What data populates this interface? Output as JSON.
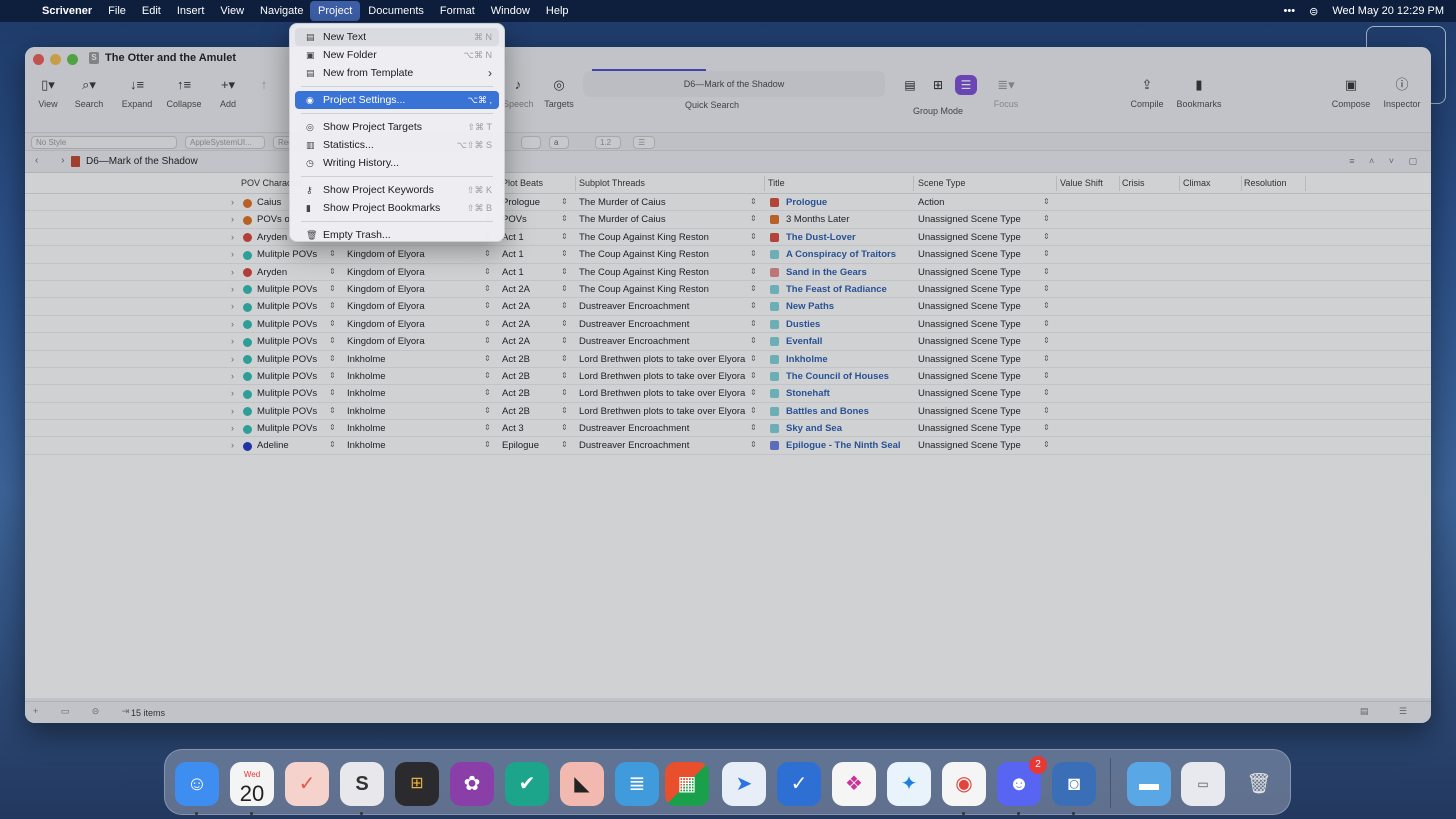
{
  "menubar": {
    "app": "Scrivener",
    "items": [
      "File",
      "Edit",
      "Insert",
      "View",
      "Navigate",
      "Project",
      "Documents",
      "Format",
      "Window",
      "Help"
    ],
    "active": "Project",
    "datetime": "Wed May 20  12:29 PM"
  },
  "window": {
    "title": "The Otter and the Amulet",
    "toolbar": {
      "view": "View",
      "search": "Search",
      "expand": "Expand",
      "collapse": "Collapse",
      "add": "Add",
      "speech": "Speech",
      "targets": "Targets",
      "quick_search_value": "D6—Mark of the Shadow",
      "quick_search": "Quick Search",
      "group_mode": "Group Mode",
      "focus": "Focus",
      "compile": "Compile",
      "bookmarks": "Bookmarks",
      "compose": "Compose",
      "inspector": "Inspector"
    },
    "format_bar": {
      "style": "No Style",
      "font": "AppleSystemUI...",
      "weight": "Reg",
      "line_spacing": "1.2"
    },
    "path": "D6—Mark of the Shadow",
    "status": {
      "count": "15 items"
    }
  },
  "columns": [
    "POV Character",
    "Plot Beats",
    "Subplot Threads",
    "Title",
    "Scene Type",
    "Value Shift",
    "Crisis",
    "Climax",
    "Resolution"
  ],
  "rows": [
    {
      "pov": "Caius",
      "dot": "#e07020",
      "setting": "",
      "beat": "Prologue",
      "thread": "The Murder of Caius",
      "title": "Prologue",
      "title_icon": "#d94b3a",
      "title_style": "blue",
      "scene": "Action"
    },
    {
      "pov": "POVs or",
      "dot": "#e07020",
      "setting": "",
      "beat": "POVs",
      "thread": "The Murder of Caius",
      "title": "3 Months Later",
      "title_icon": "#e07020",
      "title_style": "plain",
      "scene": "Unassigned Scene Type"
    },
    {
      "pov": "Aryden",
      "dot": "#d9423a",
      "setting": "",
      "beat": "Act 1",
      "thread": "The Coup Against King Reston",
      "title": "The Dust-Lover",
      "title_icon": "#d94b3a",
      "title_style": "blue",
      "scene": "Unassigned Scene Type"
    },
    {
      "pov": "Mulitple POVs",
      "dot": "#2fbfb4",
      "setting": "Kingdom of Elyora",
      "beat": "Act 1",
      "thread": "The Coup Against King Reston",
      "title": "A Conspiracy of Traitors",
      "title_icon": "#7fd3d9",
      "title_style": "blue",
      "scene": "Unassigned Scene Type"
    },
    {
      "pov": "Aryden",
      "dot": "#d9423a",
      "setting": "Kingdom of Elyora",
      "beat": "Act 1",
      "thread": "The Coup Against King Reston",
      "title": "Sand in the Gears",
      "title_icon": "#e88a8a",
      "title_style": "blue",
      "scene": "Unassigned Scene Type"
    },
    {
      "pov": "Mulitple POVs",
      "dot": "#2fbfb4",
      "setting": "Kingdom of Elyora",
      "beat": "Act 2A",
      "thread": "The Coup Against King Reston",
      "title": "The Feast of Radiance",
      "title_icon": "#7fd3d9",
      "title_style": "blue",
      "scene": "Unassigned Scene Type"
    },
    {
      "pov": "Mulitple POVs",
      "dot": "#2fbfb4",
      "setting": "Kingdom of Elyora",
      "beat": "Act 2A",
      "thread": "Dustreaver Encroachment",
      "title": "New Paths",
      "title_icon": "#7fd3d9",
      "title_style": "blue",
      "scene": "Unassigned Scene Type"
    },
    {
      "pov": "Mulitple POVs",
      "dot": "#2fbfb4",
      "setting": "Kingdom of Elyora",
      "beat": "Act 2A",
      "thread": "Dustreaver Encroachment",
      "title": "Dusties",
      "title_icon": "#7fd3d9",
      "title_style": "blue",
      "scene": "Unassigned Scene Type"
    },
    {
      "pov": "Mulitple POVs",
      "dot": "#2fbfb4",
      "setting": "Kingdom of Elyora",
      "beat": "Act 2A",
      "thread": "Dustreaver Encroachment",
      "title": "Evenfall",
      "title_icon": "#7fd3d9",
      "title_style": "blue",
      "scene": "Unassigned Scene Type"
    },
    {
      "pov": "Mulitple POVs",
      "dot": "#2fbfb4",
      "setting": "Inkholme",
      "beat": "Act 2B",
      "thread": "Lord Brethwen plots to take over Elyora",
      "title": "Inkholme",
      "title_icon": "#7fd3d9",
      "title_style": "blue",
      "scene": "Unassigned Scene Type"
    },
    {
      "pov": "Mulitple POVs",
      "dot": "#2fbfb4",
      "setting": "Inkholme",
      "beat": "Act 2B",
      "thread": "Lord Brethwen plots to take over Elyora",
      "title": "The Council of Houses",
      "title_icon": "#7fd3d9",
      "title_style": "blue",
      "scene": "Unassigned Scene Type"
    },
    {
      "pov": "Mulitple POVs",
      "dot": "#2fbfb4",
      "setting": "Inkholme",
      "beat": "Act 2B",
      "thread": "Lord Brethwen plots to take over Elyora",
      "title": "Stonehaft",
      "title_icon": "#7fd3d9",
      "title_style": "blue",
      "scene": "Unassigned Scene Type"
    },
    {
      "pov": "Mulitple POVs",
      "dot": "#2fbfb4",
      "setting": "Inkholme",
      "beat": "Act 2B",
      "thread": "Lord Brethwen plots to take over Elyora",
      "title": "Battles and Bones",
      "title_icon": "#7fd3d9",
      "title_style": "blue",
      "scene": "Unassigned Scene Type"
    },
    {
      "pov": "Mulitple POVs",
      "dot": "#2fbfb4",
      "setting": "Inkholme",
      "beat": "Act 3",
      "thread": "Dustreaver Encroachment",
      "title": "Sky and Sea",
      "title_icon": "#7fd3d9",
      "title_style": "blue",
      "scene": "Unassigned Scene Type"
    },
    {
      "pov": "Adeline",
      "dot": "#2234c4",
      "setting": "Inkholme",
      "beat": "Epilogue",
      "thread": "Dustreaver Encroachment",
      "title": "Epilogue - The Ninth Seal",
      "title_icon": "#6b7ee0",
      "title_style": "blue",
      "scene": "Unassigned Scene Type"
    }
  ],
  "menu": {
    "items": [
      {
        "icon": "▤",
        "label": "New Text",
        "shortcut": "⌘ N"
      },
      {
        "icon": "▣",
        "label": "New Folder",
        "shortcut": "⌥⌘ N"
      },
      {
        "icon": "▤",
        "label": "New from Template",
        "shortcut": "›"
      },
      {
        "icon": "◉",
        "label": "Project Settings...",
        "shortcut": "⌥⌘ ,"
      },
      {
        "icon": "◎",
        "label": "Show Project Targets",
        "shortcut": "⇧⌘ T"
      },
      {
        "icon": "▥",
        "label": "Statistics...",
        "shortcut": "⌥⇧⌘ S"
      },
      {
        "icon": "◷",
        "label": "Writing History...",
        "shortcut": ""
      },
      {
        "icon": "⚷",
        "label": "Show Project Keywords",
        "shortcut": "⇧⌘ K"
      },
      {
        "icon": "▮",
        "label": "Show Project Bookmarks",
        "shortcut": "⇧⌘ B"
      },
      {
        "icon": "🗑",
        "label": "Empty Trash...",
        "shortcut": ""
      }
    ]
  },
  "dock": {
    "calendar_day": "Wed",
    "calendar_date": "20",
    "discord_badge": "2"
  }
}
